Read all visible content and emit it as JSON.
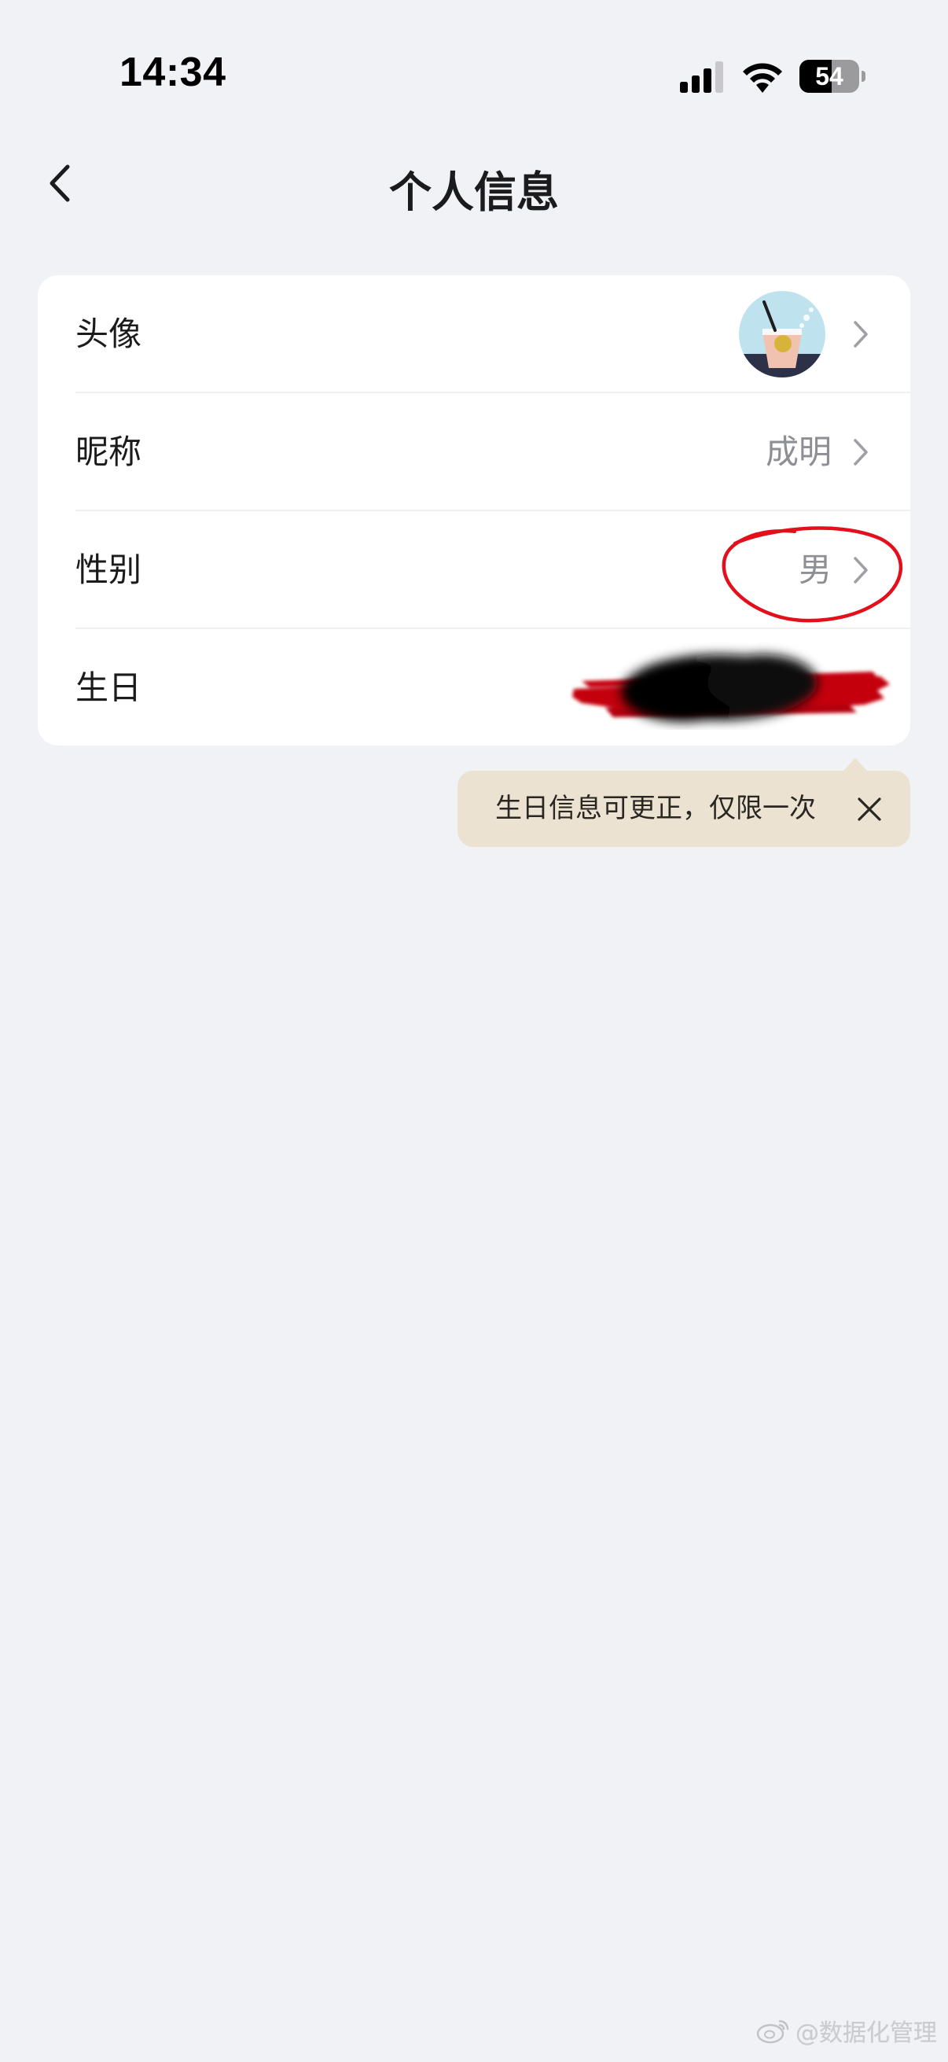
{
  "status_bar": {
    "time": "14:34",
    "battery": "54",
    "battery_level": 0.54,
    "icons": [
      "cellular-signal-icon",
      "wifi-icon",
      "battery-icon"
    ]
  },
  "nav": {
    "back_icon": "chevron-left-icon",
    "title": "个人信息"
  },
  "profile_rows": [
    {
      "label": "头像",
      "value_type": "avatar",
      "icon": "chevron-right-icon"
    },
    {
      "label": "昵称",
      "value": "成明",
      "icon": "chevron-right-icon"
    },
    {
      "label": "性别",
      "value": "男",
      "icon": "chevron-right-icon"
    },
    {
      "label": "生日",
      "value_redacted": true,
      "icon": "chevron-right-icon"
    }
  ],
  "tooltip": {
    "text": "生日信息可更正，仅限一次",
    "close_icon": "close-icon"
  },
  "watermark": {
    "text": "@数据化管理",
    "icon": "weibo-icon"
  },
  "colors": {
    "background": "#f1f2f6",
    "card": "#ffffff",
    "label_text": "#1b1b1d",
    "value_text": "#8e8f94",
    "tooltip_bg": "#ebe2d2",
    "annotation_red": "#e3101c"
  }
}
